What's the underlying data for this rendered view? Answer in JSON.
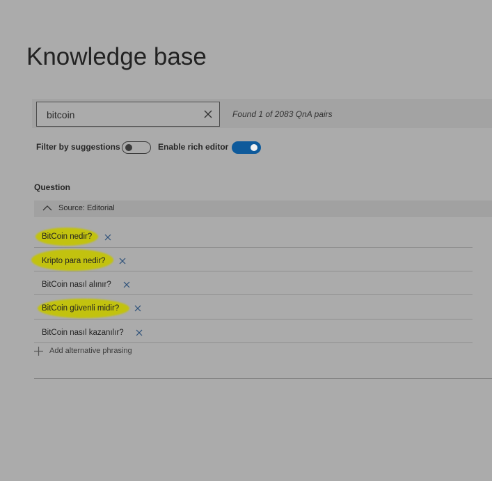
{
  "page": {
    "title": "Knowledge base"
  },
  "search": {
    "value": "bitcoin",
    "result_text": "Found 1 of 2083 QnA pairs"
  },
  "filters": {
    "suggestions_label": "Filter by suggestions",
    "suggestions_on": false,
    "rich_editor_label": "Enable rich editor",
    "rich_editor_on": true
  },
  "colors": {
    "accent": "#0e5a9b",
    "highlight": "#c2c20f",
    "background": "#ababab"
  },
  "table": {
    "column_header": "Question",
    "source_label": "Source: Editorial",
    "questions": [
      {
        "text": "BitCoin nedir?",
        "highlighted": true
      },
      {
        "text": "Kripto para nedir?",
        "highlighted": true
      },
      {
        "text": "BitCoin nasıl alınır?",
        "highlighted": false
      },
      {
        "text": "BitCoin güvenli midir?",
        "highlighted": true
      },
      {
        "text": "BitCoin nasıl kazanılır?",
        "highlighted": false
      }
    ],
    "add_label": "Add alternative phrasing"
  }
}
